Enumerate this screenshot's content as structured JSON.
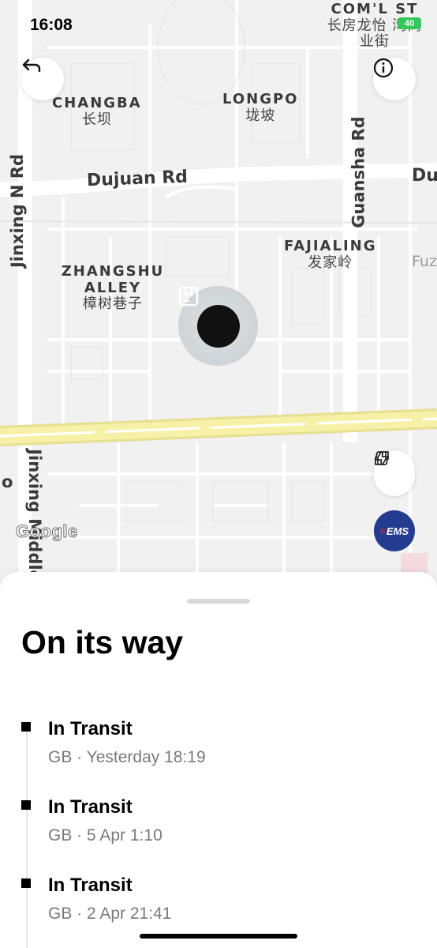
{
  "status_bar": {
    "time": "16:08",
    "battery": "40"
  },
  "map": {
    "areas": [
      {
        "en": "CHANGBA",
        "zh": "长坝"
      },
      {
        "en": "LONGPO",
        "zh": "垅坡"
      },
      {
        "en": "FAJIALING",
        "zh": "发家岭"
      },
      {
        "en": "ZHANGSHU ALLEY",
        "zh": "樟树巷子"
      },
      {
        "en": "COM'L ST",
        "zh": "长房龙怡 湾商业街"
      }
    ],
    "roads": {
      "dujuan": "Dujuan Rd",
      "dujuan_partial": "Du",
      "jinxing_n": "Jinxing N Rd",
      "jinxing_middle": "Jinxing Middle",
      "guansha": "Guansha Rd",
      "fuz_partial": "Fuz",
      "o_partial": "o"
    },
    "attribution": "Google",
    "carrier_badge": "EMS",
    "icons": {
      "back": "back-arrow-icon",
      "info": "info-icon",
      "package": "package-icon",
      "thumbs_up": "thumbs-up-icon",
      "thumbs_down": "thumbs-down-icon"
    }
  },
  "sheet": {
    "title": "On its way",
    "events": [
      {
        "status": "In Transit",
        "meta": "GB · Yesterday 18:19"
      },
      {
        "status": "In Transit",
        "meta": "GB · 5 Apr 1:10"
      },
      {
        "status": "In Transit",
        "meta": "GB · 2 Apr 21:41"
      }
    ]
  },
  "colors": {
    "highway_yellow": "#f7f1a8",
    "ems_blue": "#243c8f",
    "ems_red": "#e0242d"
  }
}
